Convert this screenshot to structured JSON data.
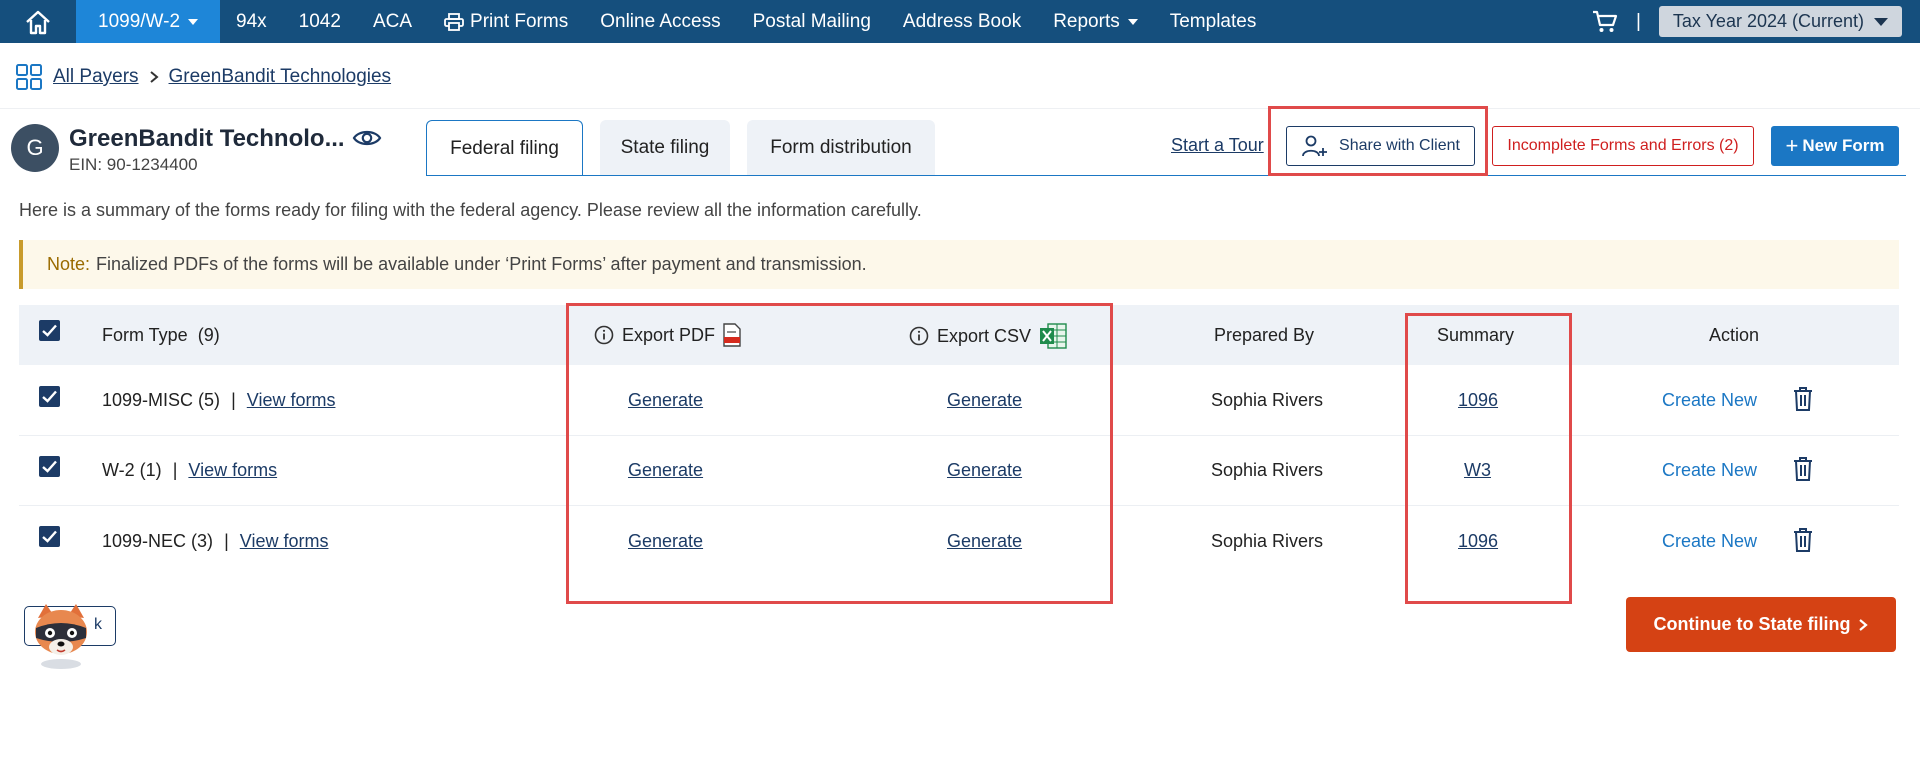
{
  "nav": {
    "items": [
      "1099/W-2",
      "94x",
      "1042",
      "ACA",
      "Print Forms",
      "Online Access",
      "Postal Mailing",
      "Address Book",
      "Reports",
      "Templates"
    ],
    "separator": "|",
    "tax_year": "Tax Year 2024 (Current)"
  },
  "breadcrumb": {
    "root": "All Payers",
    "current": "GreenBandit Technologies"
  },
  "payer": {
    "initial": "G",
    "name": "GreenBandit Technolo...",
    "ein": "EIN: 90-1234400"
  },
  "tabs": [
    "Federal filing",
    "State filing",
    "Form distribution"
  ],
  "actions": {
    "start_tour": "Start a Tour",
    "share": "Share with Client",
    "errors": "Incomplete Forms and Errors (2)",
    "new_form": "New Form"
  },
  "summary_text": "Here is a summary of the forms ready for filing with the federal agency. Please review all the information carefully.",
  "note": {
    "label": "Note:",
    "text": "Finalized PDFs of the forms will be available under ‘Print Forms’ after payment and transmission."
  },
  "table": {
    "headers": {
      "form_type": "Form Type  (9)",
      "export_pdf": "Export PDF",
      "export_csv": "Export CSV",
      "prepared_by": "Prepared By",
      "summary": "Summary",
      "action": "Action"
    },
    "separator": "|",
    "rows": [
      {
        "form": "1099-MISC (5)",
        "view": "View forms",
        "pdf": "Generate",
        "csv": "Generate",
        "prepared_by": "Sophia Rivers",
        "summary": "1096",
        "action": "Create New"
      },
      {
        "form": "W-2 (1)",
        "view": "View forms",
        "pdf": "Generate",
        "csv": "Generate",
        "prepared_by": "Sophia Rivers",
        "summary": "W3",
        "action": "Create New"
      },
      {
        "form": "1099-NEC (3)",
        "view": "View forms",
        "pdf": "Generate",
        "csv": "Generate",
        "prepared_by": "Sophia Rivers",
        "summary": "1096",
        "action": "Create New"
      }
    ]
  },
  "continue": "Continue to State filing",
  "mascot_text": "k",
  "colors": {
    "nav_bg": "#154f7d",
    "accent": "#1b77c4",
    "danger": "#cf1f1f",
    "continue": "#d54214",
    "highlight": "#e04a4a"
  }
}
